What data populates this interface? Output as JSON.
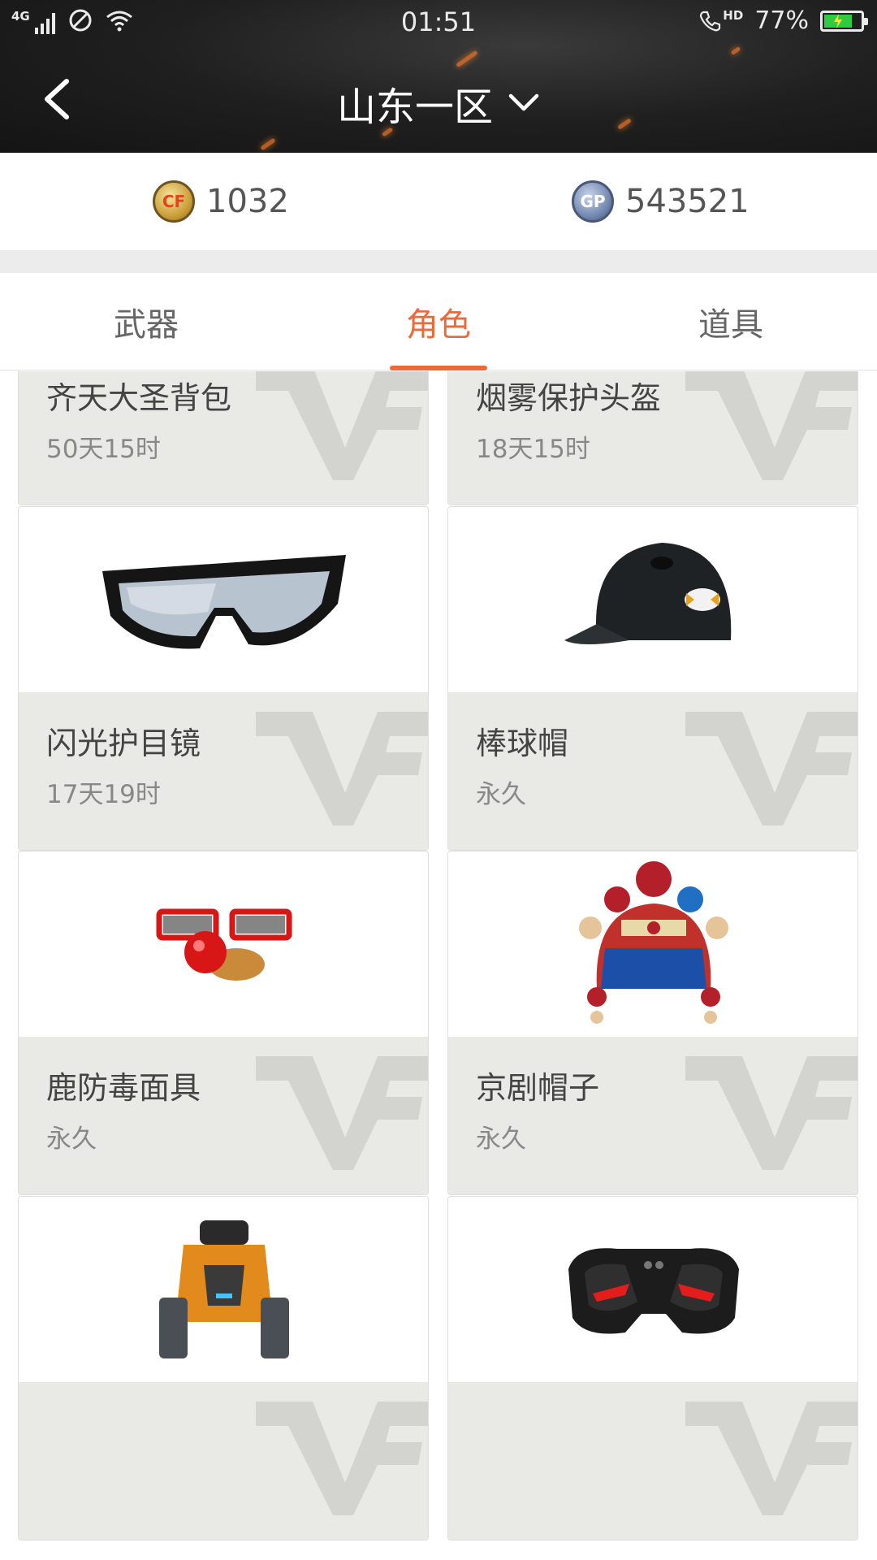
{
  "status_bar": {
    "network": "4G",
    "time": "01:51",
    "call_label": "HD",
    "battery": "77%"
  },
  "header": {
    "back_icon": "chevron-left-icon",
    "title": "山东一区",
    "dropdown_icon": "chevron-down-icon"
  },
  "currency": {
    "cf_coins": "1032",
    "cf_icon_text": "CF",
    "gp": "543521",
    "gp_icon_text": "GP"
  },
  "tabs": [
    {
      "label": "武器",
      "active": false
    },
    {
      "label": "角色",
      "active": true
    },
    {
      "label": "道具",
      "active": false
    }
  ],
  "items": [
    {
      "name": "齐天大圣背包",
      "time": "50天15时",
      "icon": "monkey-backpack-icon"
    },
    {
      "name": "烟雾保护头盔",
      "time": "18天15时",
      "icon": "smoke-helmet-icon"
    },
    {
      "name": "闪光护目镜",
      "time": "17天19时",
      "icon": "goggles-icon"
    },
    {
      "name": "棒球帽",
      "time": "永久",
      "icon": "baseball-helmet-icon"
    },
    {
      "name": "鹿防毒面具",
      "time": "永久",
      "icon": "clown-nose-glasses-icon"
    },
    {
      "name": "京剧帽子",
      "time": "永久",
      "icon": "opera-headdress-icon"
    },
    {
      "name": "",
      "time": "",
      "icon": "jetpack-icon"
    },
    {
      "name": "",
      "time": "",
      "icon": "red-eye-mask-icon"
    }
  ],
  "colors": {
    "accent": "#ec6a3a",
    "header_bg": "#1f1f1f",
    "card_info_bg": "#e9e9e6",
    "battery_fill": "#2ecc40"
  }
}
